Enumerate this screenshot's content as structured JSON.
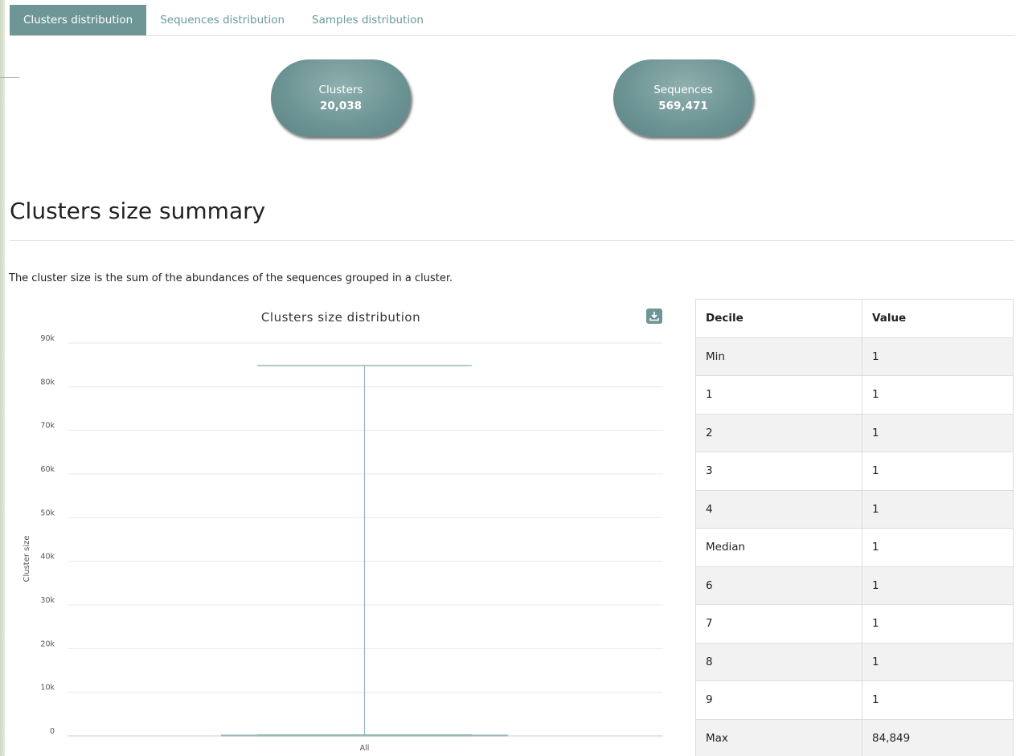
{
  "tabs": [
    {
      "label": "Clusters distribution",
      "active": true
    },
    {
      "label": "Sequences distribution",
      "active": false
    },
    {
      "label": "Samples distribution",
      "active": false
    }
  ],
  "stats": {
    "clusters": {
      "label": "Clusters",
      "value": "20,038"
    },
    "sequences": {
      "label": "Sequences",
      "value": "569,471"
    }
  },
  "section": {
    "title": "Clusters size summary",
    "description": "The cluster size is the sum of the abundances of the sequences grouped in a cluster."
  },
  "chart": {
    "download_icon": "download-icon",
    "accent": "#6f9696"
  },
  "chart_data": {
    "type": "boxplot",
    "title": "Clusters size distribution",
    "xlabel": "",
    "ylabel": "Cluster size",
    "categories": [
      "All"
    ],
    "ylim": [
      0,
      90000
    ],
    "yticks": [
      "0",
      "10k",
      "20k",
      "30k",
      "40k",
      "50k",
      "60k",
      "70k",
      "80k",
      "90k"
    ],
    "grid": true,
    "boxes": [
      {
        "category": "All",
        "min": 1,
        "q1": 1,
        "median": 1,
        "q3": 1,
        "max": 84849
      }
    ]
  },
  "table": {
    "headers": [
      "Decile",
      "Value"
    ],
    "rows": [
      [
        "Min",
        "1"
      ],
      [
        "1",
        "1"
      ],
      [
        "2",
        "1"
      ],
      [
        "3",
        "1"
      ],
      [
        "4",
        "1"
      ],
      [
        "Median",
        "1"
      ],
      [
        "6",
        "1"
      ],
      [
        "7",
        "1"
      ],
      [
        "8",
        "1"
      ],
      [
        "9",
        "1"
      ],
      [
        "Max",
        "84,849"
      ]
    ]
  }
}
